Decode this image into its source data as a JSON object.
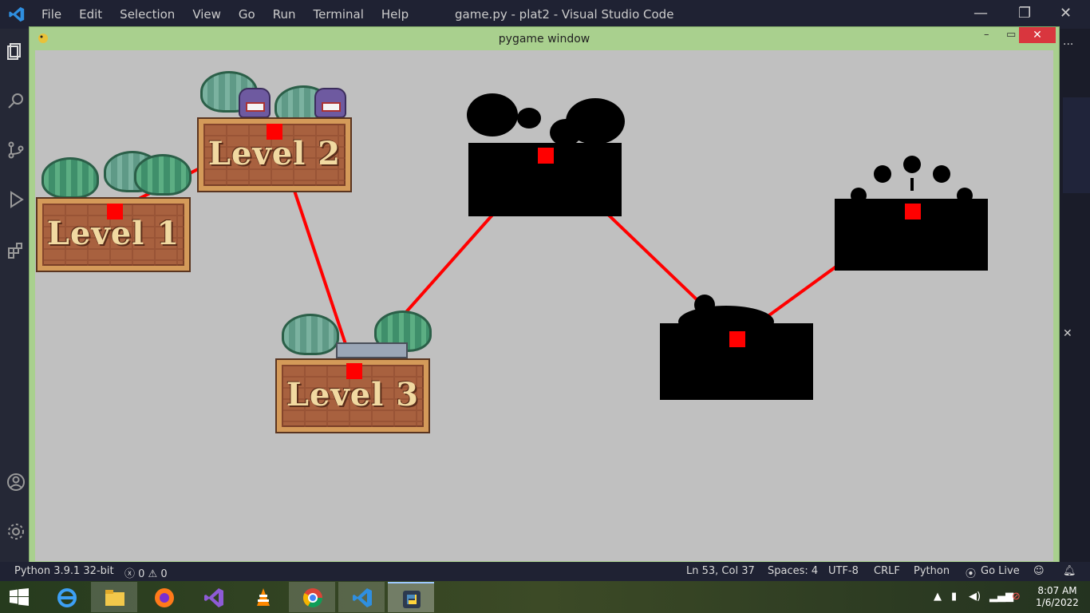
{
  "vscode": {
    "menu": [
      "File",
      "Edit",
      "Selection",
      "View",
      "Go",
      "Run",
      "Terminal",
      "Help"
    ],
    "title": "game.py - plat2 - Visual Studio Code",
    "window_controls": {
      "minimize": "—",
      "restore": "❐",
      "close": "✕"
    },
    "more": "···"
  },
  "pygame_window": {
    "title": "pygame window",
    "controls": {
      "minimize": "–",
      "maximize": "▭",
      "close": "✕"
    },
    "levels": [
      {
        "label": "Level 1"
      },
      {
        "label": "Level 2"
      },
      {
        "label": "Level 3"
      }
    ],
    "path_color": "#ff0000",
    "marker_color": "#ff0000",
    "background_color": "#c0c0c0"
  },
  "statusbar": {
    "interpreter": "Python 3.9.1 32-bit",
    "problems": "ⓧ 0 ⚠ 0",
    "position": "Ln 53, Col 37",
    "spaces": "Spaces: 4",
    "encoding": "UTF-8",
    "eol": "CRLF",
    "language": "Python",
    "go_live": "Go Live"
  },
  "taskbar": {
    "time": "8:07 AM",
    "date": "1/6/2022",
    "apps": [
      "internet-explorer",
      "file-explorer",
      "firefox",
      "visual-studio",
      "vlc",
      "chrome",
      "vs-code",
      "python"
    ]
  }
}
